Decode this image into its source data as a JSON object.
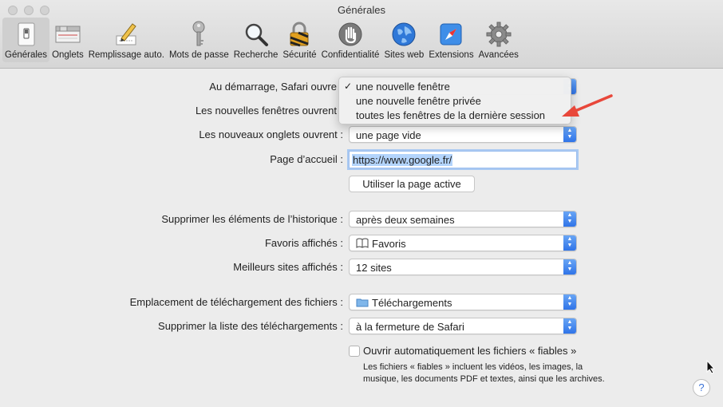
{
  "window": {
    "title": "Générales"
  },
  "toolbar": {
    "items": [
      {
        "label": "Générales",
        "icon": "general-switch-icon",
        "active": true
      },
      {
        "label": "Onglets",
        "icon": "tabs-icon"
      },
      {
        "label": "Remplissage auto.",
        "icon": "pencil-form-icon"
      },
      {
        "label": "Mots de passe",
        "icon": "key-icon"
      },
      {
        "label": "Recherche",
        "icon": "magnifier-icon"
      },
      {
        "label": "Sécurité",
        "icon": "padlock-icon"
      },
      {
        "label": "Confidentialité",
        "icon": "hand-icon"
      },
      {
        "label": "Sites web",
        "icon": "globe-icon"
      },
      {
        "label": "Extensions",
        "icon": "puzzle-compass-icon"
      },
      {
        "label": "Avancées",
        "icon": "gear-icon"
      }
    ]
  },
  "settings": {
    "startup_label": "Au démarrage, Safari ouvre",
    "new_windows_label": "Les nouvelles fenêtres ouvrent",
    "new_tabs_label": "Les nouveaux onglets ouvrent :",
    "new_tabs_value": "une page vide",
    "homepage_label": "Page d’accueil :",
    "homepage_value": "https://www.google.fr/",
    "use_current_button": "Utiliser la page active",
    "history_label": "Supprimer les éléments de l’historique :",
    "history_value": "après deux semaines",
    "favorites_label": "Favoris affichés :",
    "favorites_value": "Favoris",
    "topsites_label": "Meilleurs sites affichés :",
    "topsites_value": "12 sites",
    "download_location_label": "Emplacement de téléchargement des fichiers :",
    "download_location_value": "Téléchargements",
    "remove_downloads_label": "Supprimer la liste des téléchargements :",
    "remove_downloads_value": "à la fermeture de Safari",
    "open_safe_label": "Ouvrir automatiquement les fichiers « fiables »",
    "open_safe_note": "Les fichiers « fiables » incluent les vidéos, les images, la musique, les documents PDF et textes, ainsi que les archives."
  },
  "startup_menu": {
    "check_mark": "✓",
    "options": [
      "une nouvelle fenêtre",
      "une nouvelle fenêtre privée",
      "toutes les fenêtres de la dernière session"
    ]
  },
  "help_button": {
    "label": "?"
  },
  "colors": {
    "accent": "#2f74e8",
    "arrow": "#e8473a",
    "selection": "#b3d4fc"
  }
}
